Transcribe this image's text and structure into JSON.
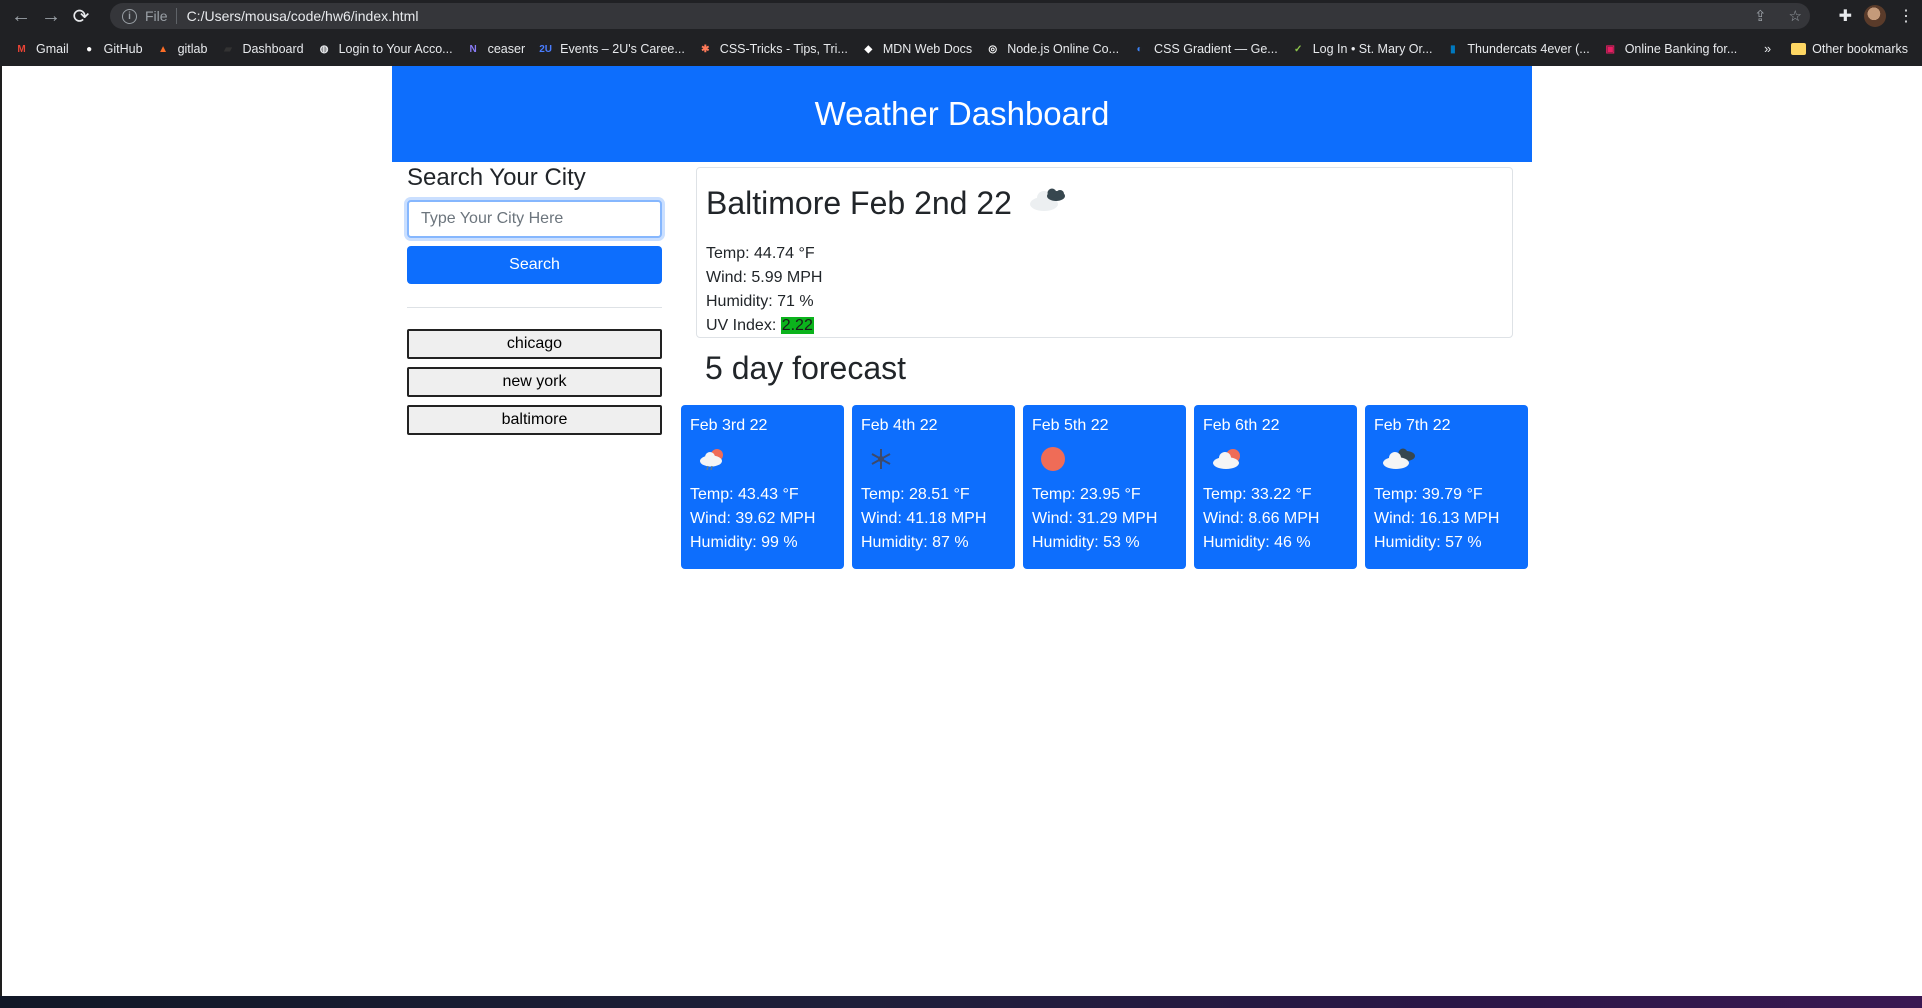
{
  "browser": {
    "url_scheme": "File",
    "url": "C:/Users/mousa/code/hw6/index.html",
    "bookmarks": [
      {
        "label": "Gmail",
        "icon": "gmail-icon",
        "color": "#ea4335",
        "glyph": "M"
      },
      {
        "label": "GitHub",
        "icon": "github-icon",
        "color": "#ffffff",
        "glyph": "●"
      },
      {
        "label": "gitlab",
        "icon": "gitlab-icon",
        "color": "#fc6d26",
        "glyph": "▲"
      },
      {
        "label": "Dashboard",
        "icon": "dashboard-icon",
        "color": "#333333",
        "glyph": "▰"
      },
      {
        "label": "Login to Your Acco...",
        "icon": "globe-icon",
        "color": "#e8eaed",
        "glyph": "◍"
      },
      {
        "label": "ceaser",
        "icon": "n-logo-icon",
        "color": "#8a7cf7",
        "glyph": "N"
      },
      {
        "label": "Events – 2U's Caree...",
        "icon": "2u-icon",
        "color": "#4a7dff",
        "glyph": "2U"
      },
      {
        "label": "CSS-Tricks - Tips, Tri...",
        "icon": "css-tricks-icon",
        "color": "#ff7a59",
        "glyph": "✱"
      },
      {
        "label": "MDN Web Docs",
        "icon": "mdn-icon",
        "color": "#ffffff",
        "glyph": "◆"
      },
      {
        "label": "Node.js Online Co...",
        "icon": "node-icon",
        "color": "#ffffff",
        "glyph": "◎"
      },
      {
        "label": "CSS Gradient — Ge...",
        "icon": "gradient-icon",
        "color": "#3b82f6",
        "glyph": "◐"
      },
      {
        "label": "Log In • St. Mary Or...",
        "icon": "check-icon",
        "color": "#8bc34a",
        "glyph": "✓"
      },
      {
        "label": "Thundercats 4ever (...",
        "icon": "trello-icon",
        "color": "#0079bf",
        "glyph": "▮"
      },
      {
        "label": "Online Banking for...",
        "icon": "bank-icon",
        "color": "#e91e63",
        "glyph": "▣"
      }
    ],
    "more_label": "»",
    "other_bookmarks": "Other bookmarks"
  },
  "header": {
    "title": "Weather Dashboard",
    "color": "#0d6efd"
  },
  "search": {
    "title": "Search Your City",
    "placeholder": "Type Your City Here",
    "value": "",
    "button_label": "Search"
  },
  "history": [
    "chicago",
    "new york",
    "baltimore"
  ],
  "current": {
    "title": "Baltimore Feb 2nd 22",
    "icon": "cloudy-icon",
    "temp": "Temp: 44.74 °F",
    "wind": "Wind: 5.99 MPH",
    "humidity": "Humidity: 71 %",
    "uv_label": "UV Index: ",
    "uv_value": "2.22",
    "uv_color": "#0bb31c"
  },
  "forecast": {
    "title": "5 day forecast",
    "days": [
      {
        "date": "Feb 3rd 22",
        "icon": "rain-sun-icon",
        "temp": "Temp: 43.43 °F",
        "wind": "Wind: 39.62 MPH",
        "humidity": "Humidity: 99 %"
      },
      {
        "date": "Feb 4th 22",
        "icon": "snow-icon",
        "temp": "Temp: 28.51 °F",
        "wind": "Wind: 41.18 MPH",
        "humidity": "Humidity: 87 %"
      },
      {
        "date": "Feb 5th 22",
        "icon": "sun-icon",
        "temp": "Temp: 23.95 °F",
        "wind": "Wind: 31.29 MPH",
        "humidity": "Humidity: 53 %"
      },
      {
        "date": "Feb 6th 22",
        "icon": "partly-cloudy-icon",
        "temp": "Temp: 33.22 °F",
        "wind": "Wind: 8.66 MPH",
        "humidity": "Humidity: 46 %"
      },
      {
        "date": "Feb 7th 22",
        "icon": "cloudy-icon",
        "temp": "Temp: 39.79 °F",
        "wind": "Wind: 16.13 MPH",
        "humidity": "Humidity: 57 %"
      }
    ]
  }
}
